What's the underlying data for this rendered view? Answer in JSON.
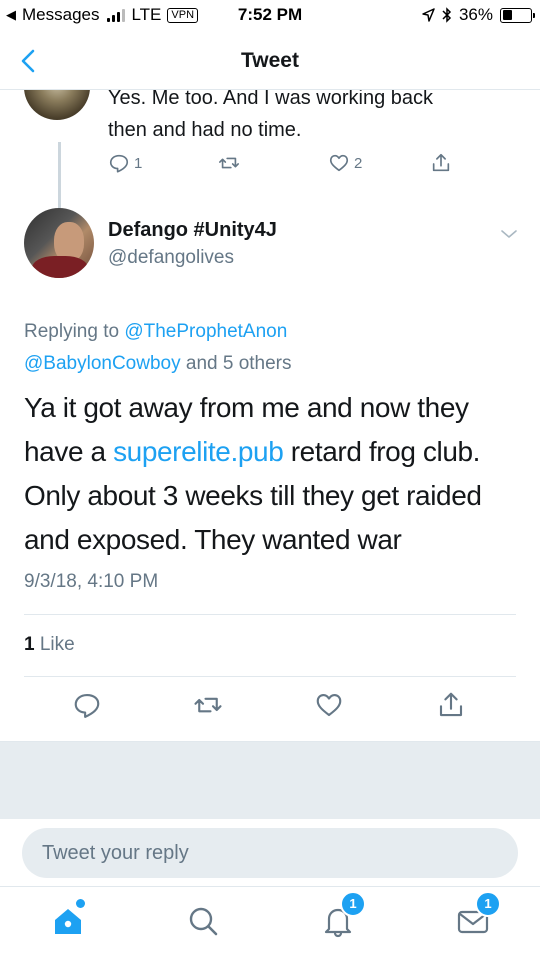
{
  "status_bar": {
    "back_app": "Messages",
    "carrier": "LTE",
    "vpn": "VPN",
    "time": "7:52 PM",
    "battery": "36%",
    "battery_level": 0.36
  },
  "nav": {
    "title": "Tweet"
  },
  "previous_tweet": {
    "text_line1": "Yes. Me too. And I was working back",
    "text_line2": "then and had no time.",
    "replies": "1",
    "likes": "2"
  },
  "tweet": {
    "display_name": "Defango #Unity4J",
    "handle": "@defangolives",
    "replying_label": "Replying to",
    "replying_user1": "@TheProphetAnon",
    "replying_user2": "@BabylonCowboy",
    "replying_rest": "and 5 others",
    "body_part1": "Ya it got away from me and now they have a ",
    "body_link": "superelite.pub",
    "body_part2": " retard frog club. Only about 3 weeks till they get raided and exposed. They wanted war",
    "timestamp": "9/3/18, 4:10 PM",
    "like_count": "1",
    "like_label": "Like"
  },
  "reply": {
    "placeholder": "Tweet your reply"
  },
  "tabs": {
    "notifications_badge": "1",
    "messages_badge": "1"
  },
  "colors": {
    "accent": "#1da1f2",
    "muted": "#657786",
    "text": "#14171a",
    "divider": "#e1e8ed",
    "band": "#e6ecf0"
  }
}
